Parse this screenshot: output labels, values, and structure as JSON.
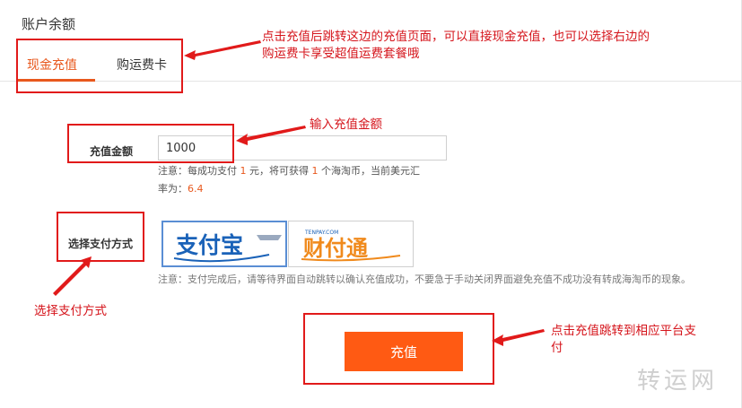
{
  "page": {
    "title": "账户余额"
  },
  "tabs": [
    {
      "label": "现金充值",
      "active": true
    },
    {
      "label": "购运费卡",
      "active": false
    }
  ],
  "form": {
    "amount_label": "充值金额",
    "amount_value": "1000",
    "note": {
      "part1": "注意：每成功支付 ",
      "pay_unit": "1",
      "part2": " 元，将可获得 ",
      "coin_unit": "1",
      "part3": " 个海淘币，当前美元汇",
      "part4": "率为：",
      "rate": "6.4"
    },
    "payment_label": "选择支付方式",
    "payment_methods": [
      {
        "name": "支付宝"
      },
      {
        "name": "财付通",
        "sub": "TENPAY.COM"
      }
    ],
    "payment_note": "注意：支付完成后，请等待界面自动跳转以确认充值成功，不要急于手动关闭界面避免充值不成功没有转成海淘币的现象。",
    "submit_label": "充值"
  },
  "annotations": {
    "tabs_note": {
      "line1": "点击充值后跳转这边的充值页面，可以直接现金充值，也可以选择右边的",
      "line2": "购运费卡享受超值运费套餐哦"
    },
    "amount_note": "输入充值金额",
    "payment_note": "选择支付方式",
    "submit_note": {
      "line1": "点击充值跳转到相应平台支",
      "line2": "付"
    }
  },
  "watermark": "转运网",
  "colors": {
    "accent": "#e8581d",
    "button": "#ff5a13",
    "annotation": "#d5141b",
    "alipay_blue": "#1a62b8",
    "tenpay_orange": "#f08a1c"
  }
}
